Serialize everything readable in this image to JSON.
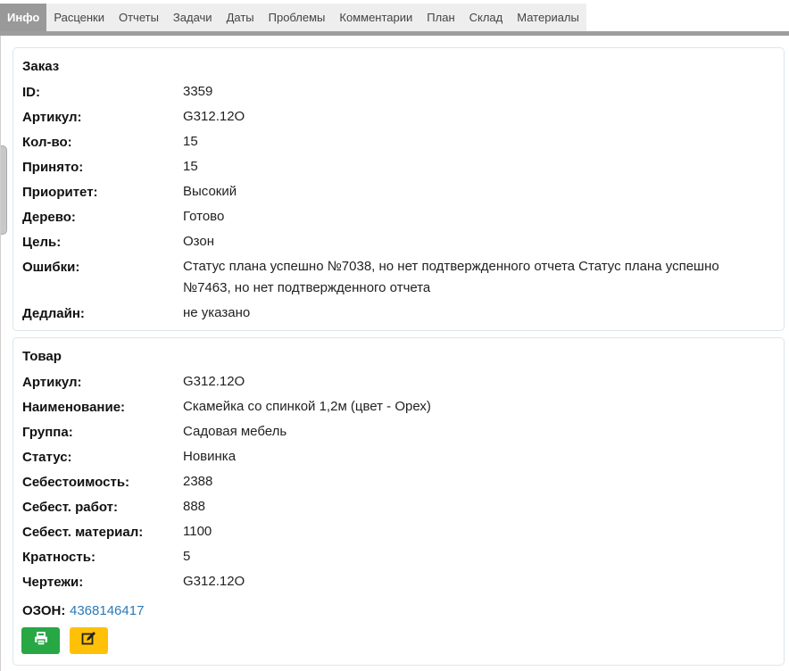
{
  "tabs": [
    "Инфо",
    "Расценки",
    "Отчеты",
    "Задачи",
    "Даты",
    "Проблемы",
    "Комментарии",
    "План",
    "Склад",
    "Материалы"
  ],
  "order": {
    "title": "Заказ",
    "rows": [
      {
        "label": "ID:",
        "value": "3359"
      },
      {
        "label": "Артикул:",
        "value": "G312.12O"
      },
      {
        "label": "Кол-во:",
        "value": "15"
      },
      {
        "label": "Принято:",
        "value": "15"
      },
      {
        "label": "Приоритет:",
        "value": "Высокий"
      },
      {
        "label": "Дерево:",
        "value": "Готово"
      },
      {
        "label": "Цель:",
        "value": "Озон"
      },
      {
        "label": "Ошибки:",
        "value": "Статус плана успешно №7038, но нет подтвержденного отчета Статус плана успешно №7463, но нет подтвержденного отчета"
      },
      {
        "label": "Дедлайн:",
        "value": "не указано"
      }
    ]
  },
  "product": {
    "title": "Товар",
    "rows": [
      {
        "label": "Артикул:",
        "value": "G312.12O"
      },
      {
        "label": "Наименование:",
        "value": "Скамейка со спинкой 1,2м (цвет - Орех)"
      },
      {
        "label": "Группа:",
        "value": "Садовая мебель"
      },
      {
        "label": "Статус:",
        "value": "Новинка"
      },
      {
        "label": "Себестоимость:",
        "value": "2388"
      },
      {
        "label": "Себест. работ:",
        "value": "888"
      },
      {
        "label": "Себест. материал:",
        "value": "1100"
      },
      {
        "label": "Кратность:",
        "value": "5"
      },
      {
        "label": "Чертежи:",
        "value": "G312.12O"
      }
    ],
    "ozon_label": "ОЗОН:",
    "ozon_value": "4368146417"
  },
  "buttons": {
    "print_icon": "print-icon",
    "edit_icon": "edit-icon",
    "print_color": "#28a745",
    "edit_color": "#ffc107"
  }
}
